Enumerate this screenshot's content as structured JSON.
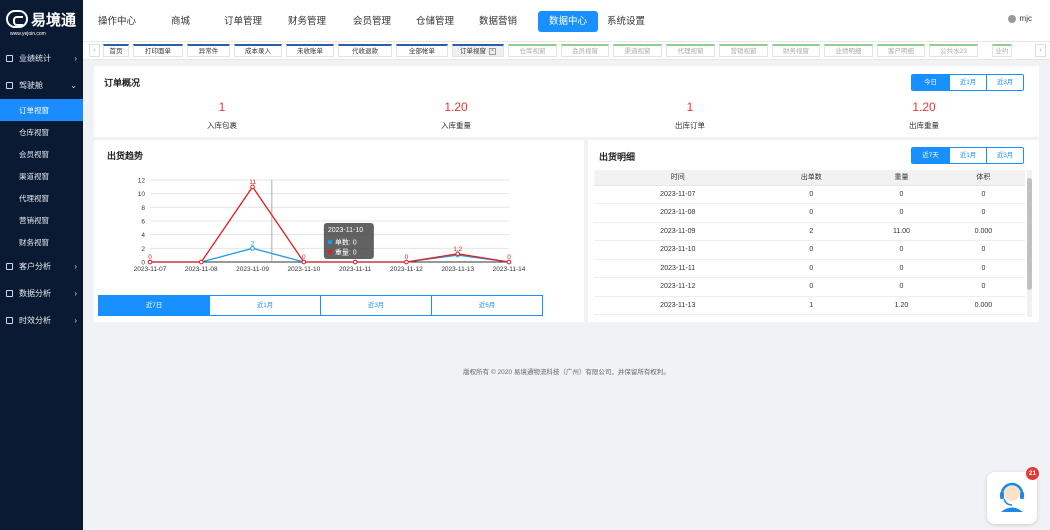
{
  "brand": {
    "name": "易境通",
    "sub": "www.yejoin.com"
  },
  "sidebar": {
    "items": [
      {
        "label": "业绩统计",
        "expanded": false,
        "icon": "bar-chart-icon"
      },
      {
        "label": "驾驶舱",
        "expanded": true,
        "icon": "dashboard-icon",
        "children": [
          "订单视窗",
          "仓库视窗",
          "会员视窗",
          "渠道视窗",
          "代理视窗",
          "营销视窗",
          "财务视窗"
        ],
        "active_child": 0
      },
      {
        "label": "客户分析",
        "expanded": false,
        "icon": "customer-icon"
      },
      {
        "label": "数据分析",
        "expanded": false,
        "icon": "data-icon"
      },
      {
        "label": "时效分析",
        "expanded": false,
        "icon": "clock-icon"
      }
    ]
  },
  "topnav": {
    "items": [
      "操作中心",
      "商城",
      "订单管理",
      "财务管理",
      "会员管理",
      "仓储管理",
      "数据营销",
      "数据中心",
      "系统设置"
    ],
    "active": "数据中心",
    "user": "mjc"
  },
  "tabs": [
    {
      "label": "首页",
      "state": "normal"
    },
    {
      "label": "打印面单",
      "state": "normal"
    },
    {
      "label": "异常件",
      "state": "normal"
    },
    {
      "label": "成本录入",
      "state": "normal"
    },
    {
      "label": "未收账单",
      "state": "normal"
    },
    {
      "label": "代收退款",
      "state": "normal"
    },
    {
      "label": "全部帐单",
      "state": "normal"
    },
    {
      "label": "订单视窗",
      "state": "current"
    },
    {
      "label": "仓库视窗",
      "state": "inactive"
    },
    {
      "label": "会员视窗",
      "state": "inactive"
    },
    {
      "label": "渠道视窗",
      "state": "inactive"
    },
    {
      "label": "代理视窗",
      "state": "inactive"
    },
    {
      "label": "营销视窗",
      "state": "inactive"
    },
    {
      "label": "财务视窗",
      "state": "inactive"
    },
    {
      "label": "业绩明细",
      "state": "inactive"
    },
    {
      "label": "客户明细",
      "state": "inactive"
    },
    {
      "label": "公共水23",
      "state": "inactive"
    },
    {
      "label": "业约",
      "state": "inactive"
    }
  ],
  "overview": {
    "title": "订单概况",
    "ranges": [
      "今日",
      "近1月",
      "近3月"
    ],
    "active_range": 0,
    "stats": [
      {
        "value": "1",
        "label": "入库包裹"
      },
      {
        "value": "1.20",
        "label": "入库重量"
      },
      {
        "value": "1",
        "label": "出库订单"
      },
      {
        "value": "1.20",
        "label": "出库重量"
      }
    ]
  },
  "trend": {
    "title": "出货趋势",
    "ranges": [
      "近7日",
      "近1月",
      "近3月",
      "近6月"
    ],
    "active_range": 0,
    "tooltip": {
      "date": "2023-11-10",
      "lines": [
        "单数: 0",
        "重量: 0"
      ]
    }
  },
  "chart_data": {
    "type": "line",
    "categories": [
      "2023-11-07",
      "2023-11-08",
      "2023-11-09",
      "2023-11-10",
      "2023-11-11",
      "2023-11-12",
      "2023-11-13",
      "2023-11-14"
    ],
    "series": [
      {
        "name": "单数",
        "values": [
          0,
          0,
          2,
          0,
          0,
          0,
          1,
          0
        ],
        "color": "#1e9be5"
      },
      {
        "name": "重量",
        "values": [
          0,
          0,
          11,
          0,
          0,
          0,
          1.2,
          0
        ],
        "color": "#e02020"
      }
    ],
    "data_labels": [
      {
        "series": 0,
        "index": 2,
        "text": "2"
      },
      {
        "series": 1,
        "index": 0,
        "text": "0"
      },
      {
        "series": 1,
        "index": 2,
        "text": "11"
      },
      {
        "series": 1,
        "index": 3,
        "text": "0"
      },
      {
        "series": 1,
        "index": 5,
        "text": "0"
      },
      {
        "series": 1,
        "index": 6,
        "text": "1.2"
      },
      {
        "series": 1,
        "index": 7,
        "text": "0"
      }
    ],
    "yticks": [
      "0",
      "2",
      "4",
      "6",
      "8",
      "10",
      "12"
    ],
    "ylim": [
      0,
      12
    ],
    "grid": true
  },
  "detail": {
    "title": "出货明细",
    "ranges": [
      "近7天",
      "近1月",
      "近3月"
    ],
    "active_range": 0,
    "columns": [
      "时间",
      "出单数",
      "重量",
      "体积"
    ],
    "rows": [
      [
        "2023-11-07",
        "0",
        "0",
        "0"
      ],
      [
        "2023-11-08",
        "0",
        "0",
        "0"
      ],
      [
        "2023-11-09",
        "2",
        "11.00",
        "0.000"
      ],
      [
        "2023-11-10",
        "0",
        "0",
        "0"
      ],
      [
        "2023-11-11",
        "0",
        "0",
        "0"
      ],
      [
        "2023-11-12",
        "0",
        "0",
        "0"
      ],
      [
        "2023-11-13",
        "1",
        "1.20",
        "0.000"
      ]
    ]
  },
  "footer": "版权所有 © 2020 易境通物流科技（广州）有限公司，并保留所有权利。",
  "service": {
    "badge": "21"
  },
  "colors": {
    "primary": "#1890ff",
    "sidebar": "#0b1a33",
    "value": "#e53935"
  }
}
